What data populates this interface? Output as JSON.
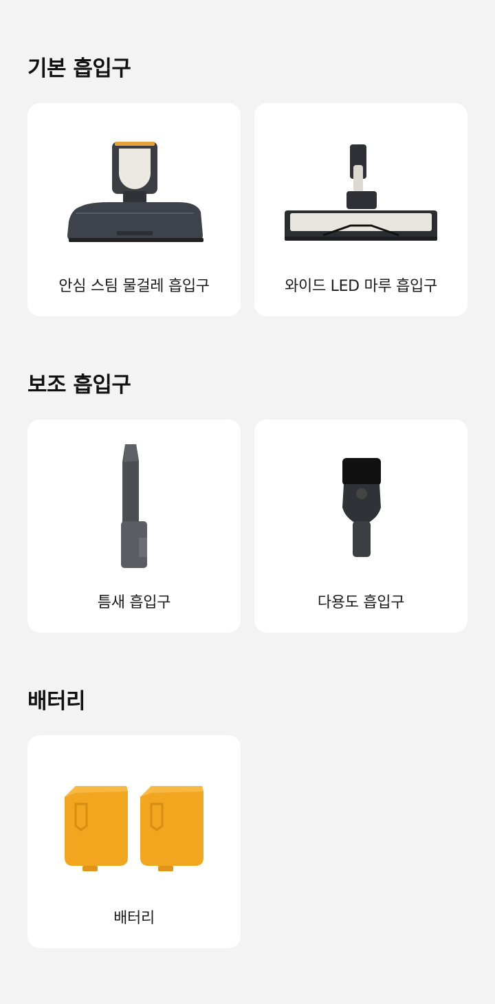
{
  "sections": [
    {
      "title": "기본 흡입구",
      "items": [
        {
          "label": "안심 스팀 물걸레 흡입구",
          "icon": "steam-mop-nozzle-icon"
        },
        {
          "label": "와이드 LED 마루 흡입구",
          "icon": "wide-led-floor-nozzle-icon"
        }
      ]
    },
    {
      "title": "보조 흡입구",
      "items": [
        {
          "label": "틈새 흡입구",
          "icon": "crevice-nozzle-icon"
        },
        {
          "label": "다용도 흡입구",
          "icon": "multi-purpose-nozzle-icon"
        }
      ]
    },
    {
      "title": "배터리",
      "items": [
        {
          "label": "배터리",
          "icon": "battery-icon"
        }
      ]
    }
  ],
  "colors": {
    "background": "#f3f3f3",
    "card": "#ffffff",
    "battery": "#f5a623",
    "dark_gray": "#3b3f45"
  }
}
